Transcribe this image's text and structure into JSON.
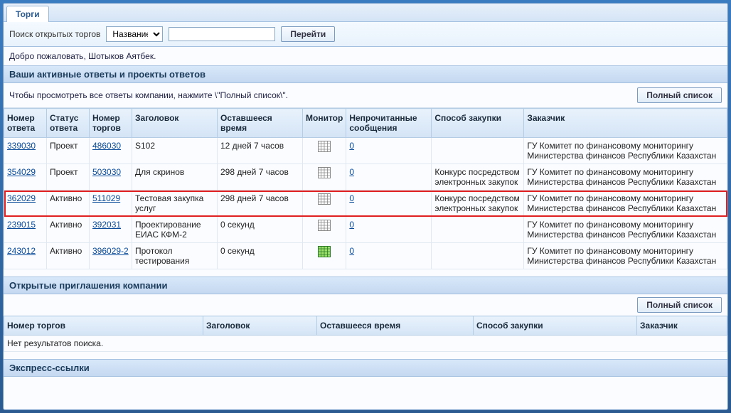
{
  "tab": "Торги",
  "search": {
    "label": "Поиск открытых торгов",
    "field": "Название",
    "value": "",
    "go": "Перейти"
  },
  "welcome": "Добро пожаловать, Шотыков Аятбек.",
  "sections": {
    "active": "Ваши активные ответы и проекты ответов",
    "invites": "Открытые приглашения компании",
    "quick": "Экспресс-ссылки"
  },
  "hint": "Чтобы просмотреть все ответы компании, нажмите \\\"Полный список\\\".",
  "full_list": "Полный список",
  "cols": {
    "response_num": "Номер ответа",
    "status": "Статус ответа",
    "auction_num": "Номер торгов",
    "title": "Заголовок",
    "time": "Оставшееся время",
    "monitor": "Монитор",
    "unread": "Непрочитанные сообщения",
    "method": "Способ закупки",
    "customer": "Заказчик"
  },
  "rows": [
    {
      "rnum": "339030",
      "status": "Проект",
      "anum": "486030",
      "title": "S102",
      "time": "12 дней 7 часов",
      "unread": "0",
      "method": "",
      "cust": "ГУ Комитет по финансовому мониторингу Министерства финансов Республики Казахстан",
      "icon": "plain"
    },
    {
      "rnum": "354029",
      "status": "Проект",
      "anum": "503030",
      "title": "Для скринов",
      "time": "298 дней 7 часов",
      "unread": "0",
      "method": "Конкурс посредством электронных закупок",
      "cust": "ГУ Комитет по финансовому мониторингу Министерства финансов Республики Казахстан",
      "icon": "plain"
    },
    {
      "rnum": "362029",
      "status": "Активно",
      "anum": "511029",
      "title": "Тестовая закупка услуг",
      "time": "298 дней 7 часов",
      "unread": "0",
      "method": "Конкурс посредством электронных закупок",
      "cust": "ГУ Комитет по финансовому мониторингу Министерства финансов Республики Казахстан",
      "icon": "plain",
      "hl": true
    },
    {
      "rnum": "239015",
      "status": "Активно",
      "anum": "392031",
      "title": "Проектирование ЕИАС КФМ-2",
      "time": "0 секунд",
      "unread": "0",
      "method": "",
      "cust": "ГУ Комитет по финансовому мониторингу Министерства финансов Республики Казахстан",
      "icon": "plain"
    },
    {
      "rnum": "243012",
      "status": "Активно",
      "anum": "396029-2",
      "title": "Протокол тестирования",
      "time": "0 секунд",
      "unread": "0",
      "method": "",
      "cust": "ГУ Комитет по финансовому мониторингу Министерства финансов Республики Казахстан",
      "icon": "green"
    }
  ],
  "cols2": {
    "auction_num": "Номер торгов",
    "title": "Заголовок",
    "time": "Оставшееся время",
    "method": "Способ закупки",
    "customer": "Заказчик"
  },
  "no_results": "Нет результатов поиска."
}
